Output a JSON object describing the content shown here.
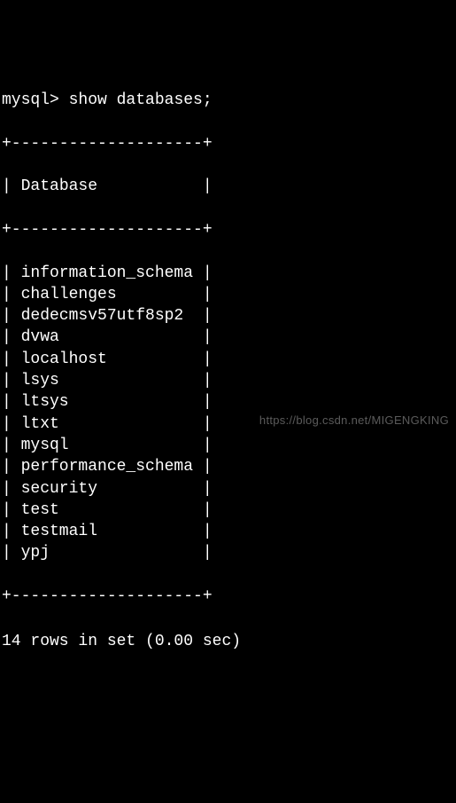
{
  "terminal": {
    "prompt": "mysql>",
    "command": "show databases;",
    "border_top": "+--------------------+",
    "border_mid": "+--------------------+",
    "border_bottom": "+--------------------+",
    "column_header": "Database",
    "rows": [
      "information_schema",
      "challenges",
      "dedecmsv57utf8sp2",
      "dvwa",
      "localhost",
      "lsys",
      "ltsys",
      "ltxt",
      "mysql",
      "performance_schema",
      "security",
      "test",
      "testmail",
      "ypj"
    ],
    "summary": "14 rows in set (0.00 sec)"
  },
  "watermark": "https://blog.csdn.net/MIGENGKING"
}
